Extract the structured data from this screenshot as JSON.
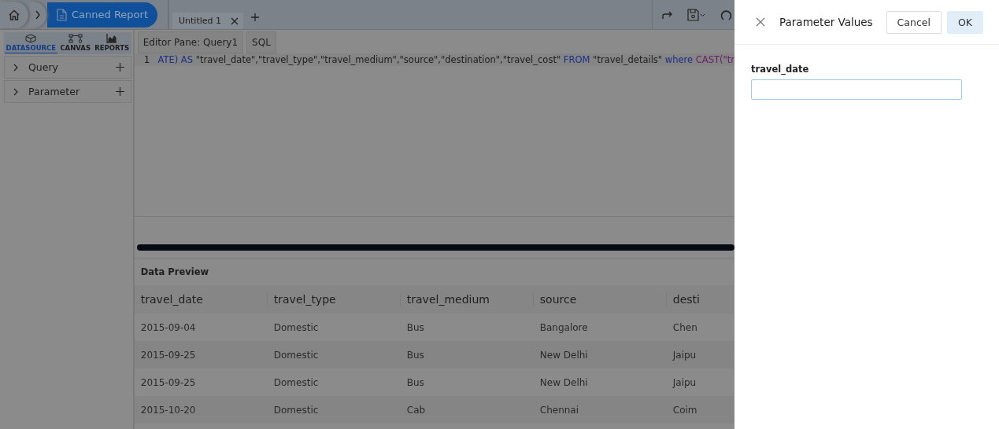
{
  "breadcrumb": {
    "title": "Canned Report"
  },
  "sidebar": {
    "tabs": [
      {
        "label": "DATASOURCE",
        "kind": "datasource",
        "selected": true
      },
      {
        "label": "CANVAS",
        "kind": "canvas",
        "selected": false
      },
      {
        "label": "REPORTS",
        "kind": "reports",
        "selected": false
      }
    ],
    "sections": [
      {
        "label": "Query",
        "expanded": false
      },
      {
        "label": "Parameter",
        "expanded": false
      }
    ]
  },
  "document_tabs": [
    {
      "label": "Untitled 1"
    }
  ],
  "editor": {
    "pane_label": "Editor Pane: Query1",
    "mode": "SQL",
    "line_number": "1",
    "tokens": [
      {
        "kind": "keyword",
        "text": "ATE) AS"
      },
      {
        "kind": "string",
        "text": "\"travel_date\",\"travel_type\",\"travel_medium\",\"source\",\"destination\",\"travel_cost\""
      },
      {
        "kind": "keyword",
        "text": "FROM"
      },
      {
        "kind": "string",
        "text": "\"travel_details\""
      },
      {
        "kind": "keyword",
        "text": "where"
      },
      {
        "kind": "function",
        "text": "CAST(\"tr"
      }
    ]
  },
  "data_preview": {
    "title": "Data Preview",
    "columns": [
      "travel_date",
      "travel_type",
      "travel_medium",
      "source",
      "desti"
    ],
    "rows": [
      [
        "2015-09-04",
        "Domestic",
        "Bus",
        "Bangalore",
        "Chen"
      ],
      [
        "2015-09-25",
        "Domestic",
        "Bus",
        "New Delhi",
        "Jaipu"
      ],
      [
        "2015-09-25",
        "Domestic",
        "Bus",
        "New Delhi",
        "Jaipu"
      ],
      [
        "2015-10-20",
        "Domestic",
        "Cab",
        "Chennai",
        "Coim"
      ]
    ]
  },
  "dialog": {
    "title": "Parameter Values",
    "buttons": [
      {
        "label": "Cancel",
        "kind": "secondary"
      },
      {
        "label": "OK",
        "kind": "primary"
      }
    ],
    "field_label": "travel_date"
  }
}
